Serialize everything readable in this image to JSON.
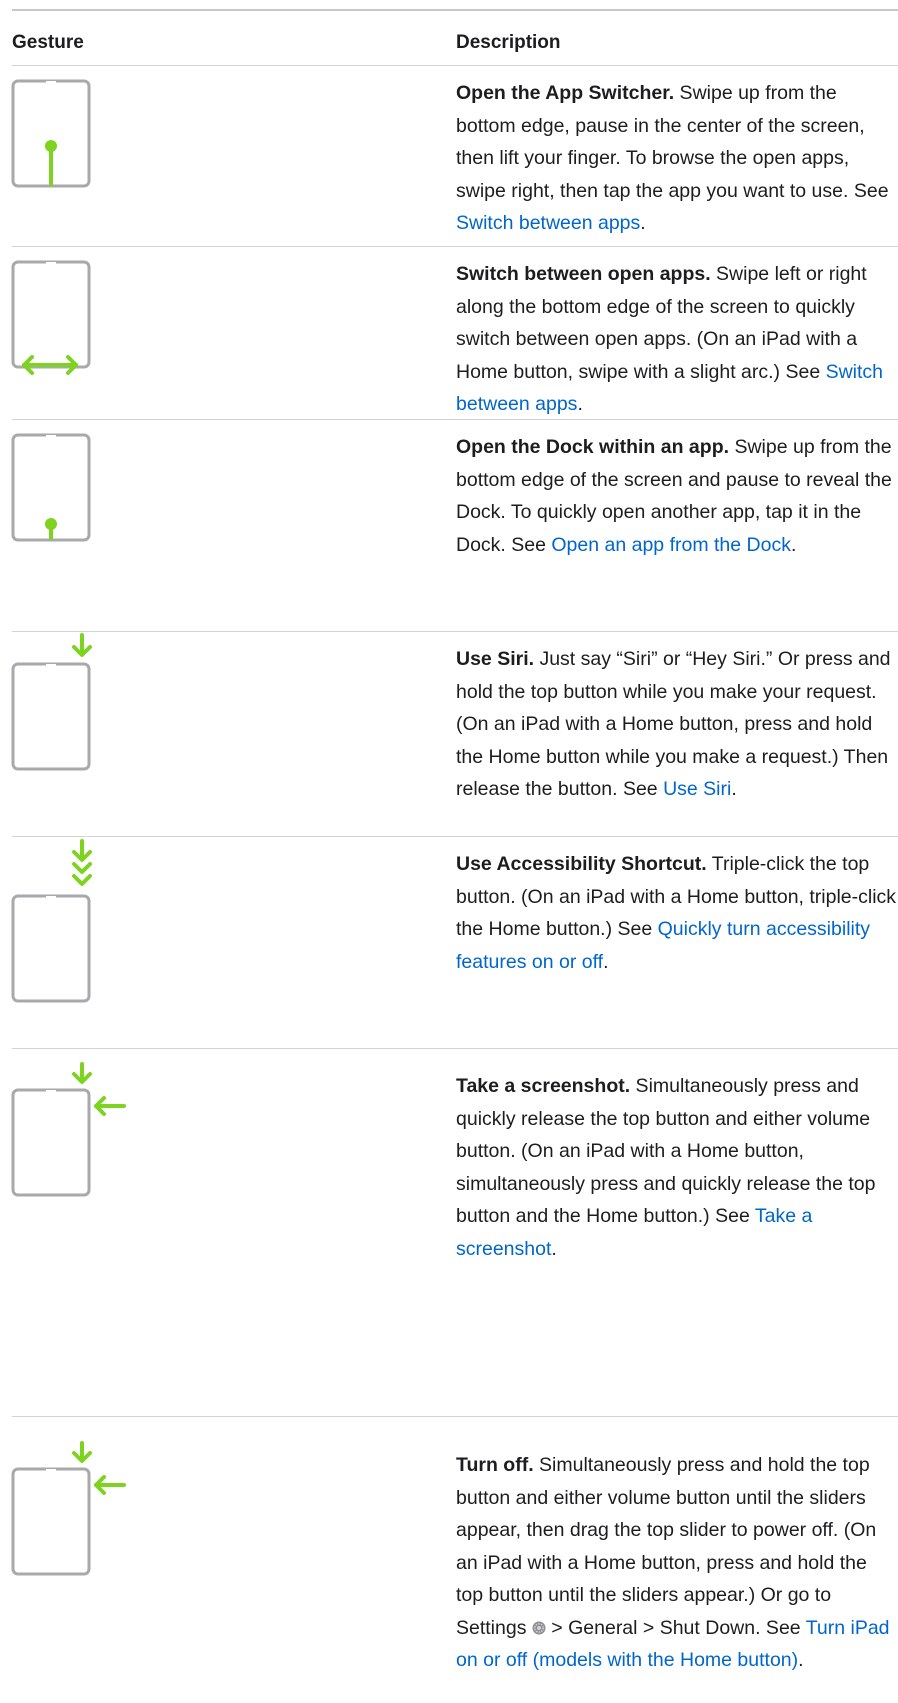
{
  "header": {
    "gesture": "Gesture",
    "description": "Description"
  },
  "colors": {
    "accent": "#7ed321",
    "device": "#a9a9ad",
    "link": "#0066cc",
    "rule": "#d2d2d7"
  },
  "rows": [
    {
      "icon": "swipe-up-pause-gesture-icon",
      "title": "Open the App Switcher.",
      "t1": " Swipe up from the bottom edge, pause in the center of the screen, then lift your finger. To browse the open apps, swipe right, then tap the app you want to use. See ",
      "link": "Switch between apps",
      "t2": "."
    },
    {
      "icon": "swipe-left-right-gesture-icon",
      "title": "Switch between open apps.",
      "t1": " Swipe left or right along the bottom edge of the screen to quickly switch between open apps. (On an iPad with a Home button, swipe with a slight arc.) See ",
      "link": "Switch between apps",
      "t2": "."
    },
    {
      "icon": "swipe-up-short-gesture-icon",
      "title": "Open the Dock within an app.",
      "t1": " Swipe up from the bottom edge of the screen and pause to reveal the Dock. To quickly open another app, tap it in the Dock. See ",
      "link": "Open an app from the Dock",
      "t2": "."
    },
    {
      "icon": "press-top-button-icon",
      "title": "Use Siri.",
      "t1": " Just say “Siri” or “Hey Siri.” Or press and hold the top button while you make your request. (On an iPad with a Home button, press and hold the Home button while you make a request.) Then release the button. See ",
      "link": "Use Siri",
      "t2": "."
    },
    {
      "icon": "triple-click-top-button-icon",
      "title": "Use Accessibility Shortcut.",
      "t1": " Triple-click the top button. (On an iPad with a Home button, triple-click the Home button.) See ",
      "link": "Quickly turn accessibility features on or off",
      "t2": "."
    },
    {
      "icon": "press-top-and-volume-buttons-icon",
      "title": "Take a screenshot.",
      "t1": " Simultaneously press and quickly release the top button and either volume button. (On an iPad with a Home button, simultaneously press and quickly release the top button and the Home button.) See ",
      "link": "Take a screenshot",
      "t2": "."
    },
    {
      "icon": "press-hold-top-and-volume-buttons-icon",
      "title": "Turn off.",
      "t1": " Simultaneously press and hold the top button and either volume button until the sliders appear, then drag the top slider to power off. (On an iPad with a Home button, press and hold the top button until the sliders appear.) Or go to Settings ",
      "settings_icon": "settings-gear-icon",
      "t1b": " > General > Shut Down. See ",
      "link": "Turn iPad on or off (models with the Home button)",
      "t2": "."
    }
  ]
}
